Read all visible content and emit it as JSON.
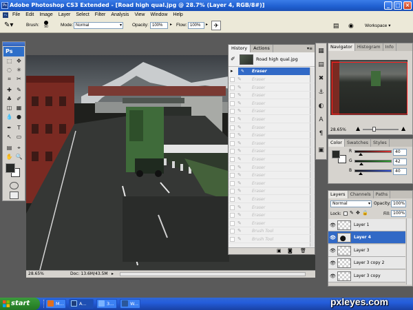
{
  "window": {
    "title": "Adobe Photoshop CS3 Extended - [Road high qual.jpg @ 28.7% (Layer 4, RGB/8#)]",
    "controls": [
      "_",
      "□",
      "×"
    ]
  },
  "menu": [
    "File",
    "Edit",
    "Image",
    "Layer",
    "Select",
    "Filter",
    "Analysis",
    "View",
    "Window",
    "Help"
  ],
  "options": {
    "brush_label": "Brush:",
    "brush_size": "90",
    "mode_label": "Mode:",
    "mode_value": "Normal",
    "opacity_label": "Opacity:",
    "opacity_value": "100%",
    "flow_label": "Flow:",
    "flow_value": "100%",
    "workspace_label": "Workspace ▾"
  },
  "tools": {
    "logo": "Ps",
    "icons": [
      "marquee-icon",
      "move-icon",
      "lasso-icon",
      "magic-wand-icon",
      "crop-icon",
      "slice-icon",
      "healing-icon",
      "brush-icon",
      "stamp-icon",
      "history-brush-icon",
      "eraser-icon",
      "gradient-icon",
      "blur-icon",
      "dodge-icon",
      "pen-icon",
      "type-icon",
      "path-select-icon",
      "shape-icon",
      "notes-icon",
      "eyedropper-icon",
      "hand-icon",
      "zoom-icon"
    ],
    "glyphs": [
      "⬚",
      "✥",
      "◌",
      "✳",
      "⌗",
      "✂",
      "✚",
      "✎",
      "♣",
      "✐",
      "◫",
      "▦",
      "💧",
      "●",
      "✒",
      "T",
      "↖",
      "▭",
      "▤",
      "⌖",
      "✋",
      "🔍"
    ]
  },
  "history": {
    "tabs": [
      "History",
      "Actions"
    ],
    "snapshot": "Road high qual.jpg",
    "current": "Eraser",
    "items": [
      "Eraser",
      "Eraser",
      "Eraser",
      "Eraser",
      "Eraser",
      "Eraser",
      "Eraser",
      "Eraser",
      "Eraser",
      "Eraser",
      "Eraser",
      "Eraser",
      "Eraser",
      "Eraser",
      "Eraser",
      "Eraser",
      "Eraser",
      "Eraser",
      "Eraser",
      "Brush Tool",
      "Brush Tool"
    ]
  },
  "status": {
    "zoom": "28.65%",
    "doc": "Doc: 13.6M/43.5M"
  },
  "navigator": {
    "tabs": [
      "Navigator",
      "Histogram",
      "Info"
    ],
    "zoom": "28.65%"
  },
  "color": {
    "tabs": [
      "Color",
      "Swatches",
      "Styles"
    ],
    "channels": [
      {
        "label": "R",
        "value": "40",
        "color": "#e23030"
      },
      {
        "label": "G",
        "value": "42",
        "color": "#2ea02e"
      },
      {
        "label": "B",
        "value": "40",
        "color": "#3050d8"
      }
    ]
  },
  "layers": {
    "tabs": [
      "Layers",
      "Channels",
      "Paths"
    ],
    "blend_mode": "Normal",
    "opacity_label": "Opacity:",
    "opacity_value": "100%",
    "lock_label": "Lock:",
    "fill_label": "Fill:",
    "fill_value": "100%",
    "items": [
      "Layer 1",
      "Layer 4",
      "Layer 3",
      "Layer 3 copy 2",
      "Layer 3 copy"
    ],
    "selected": "Layer 4"
  },
  "taskbar": {
    "start": "start",
    "tasks": [
      "M...",
      "A...",
      "3...",
      "W..."
    ]
  },
  "watermark": "pxleyes.com"
}
